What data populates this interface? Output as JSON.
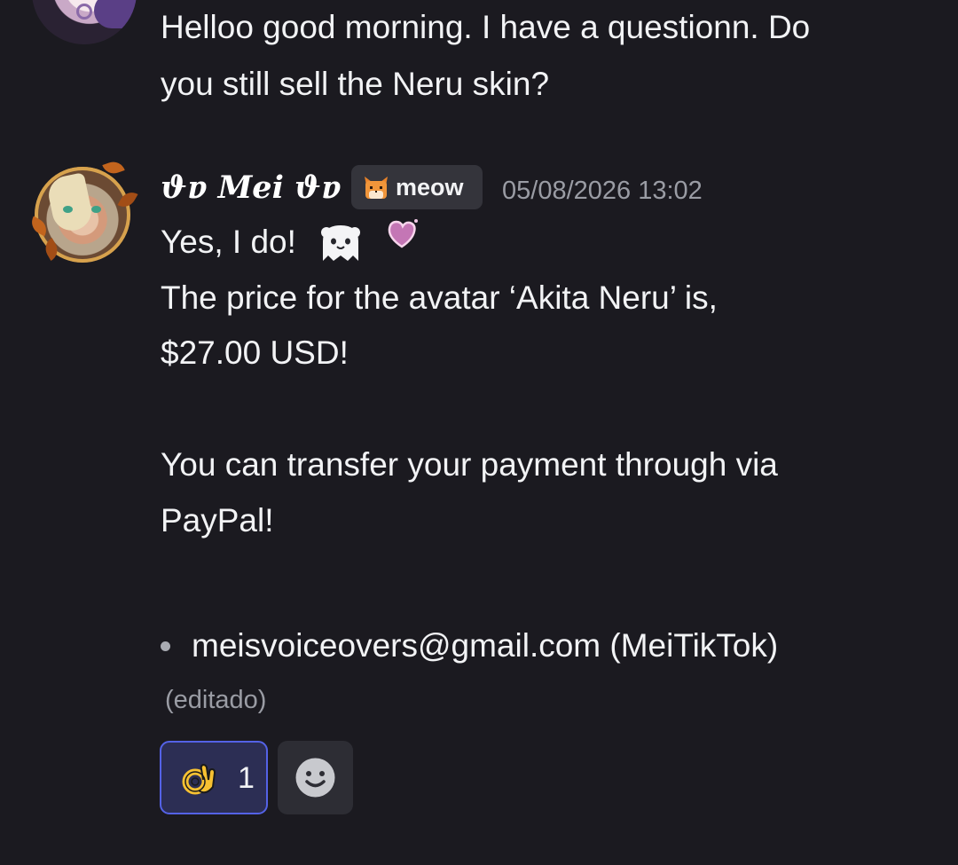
{
  "previous_message": {
    "text_line1": "Helloo good morning. I have a questionn. Do",
    "text_line2": "you still sell the Neru skin?"
  },
  "message": {
    "username": "ϑɐ Mei ϑɐ",
    "tag": {
      "icon": "cat-face-icon",
      "label": "meow"
    },
    "timestamp": "05/08/2026 13:02",
    "line1": "Yes, I do!",
    "line2": "The price for the avatar ‘Akita Neru’ is,",
    "line3": "$27.00 USD!",
    "line4": "You can transfer your payment through via",
    "line5": "PayPal!",
    "bullet_item": "meisvoiceovers@gmail.com (MeiTikTok)",
    "edited_label": "(editado)",
    "emojis": [
      "ghost-icon",
      "heart-icon"
    ]
  },
  "reactions": [
    {
      "emoji": "ok-hand-icon",
      "count": "1",
      "selected": true
    }
  ],
  "add_reaction": {
    "icon": "add-reaction-smile-icon"
  },
  "colors": {
    "background": "#1b1a20",
    "text": "#f2f3f5",
    "muted": "#9a9ca4",
    "reaction_border": "#5462e6",
    "reaction_bg": "#2c2e54"
  }
}
